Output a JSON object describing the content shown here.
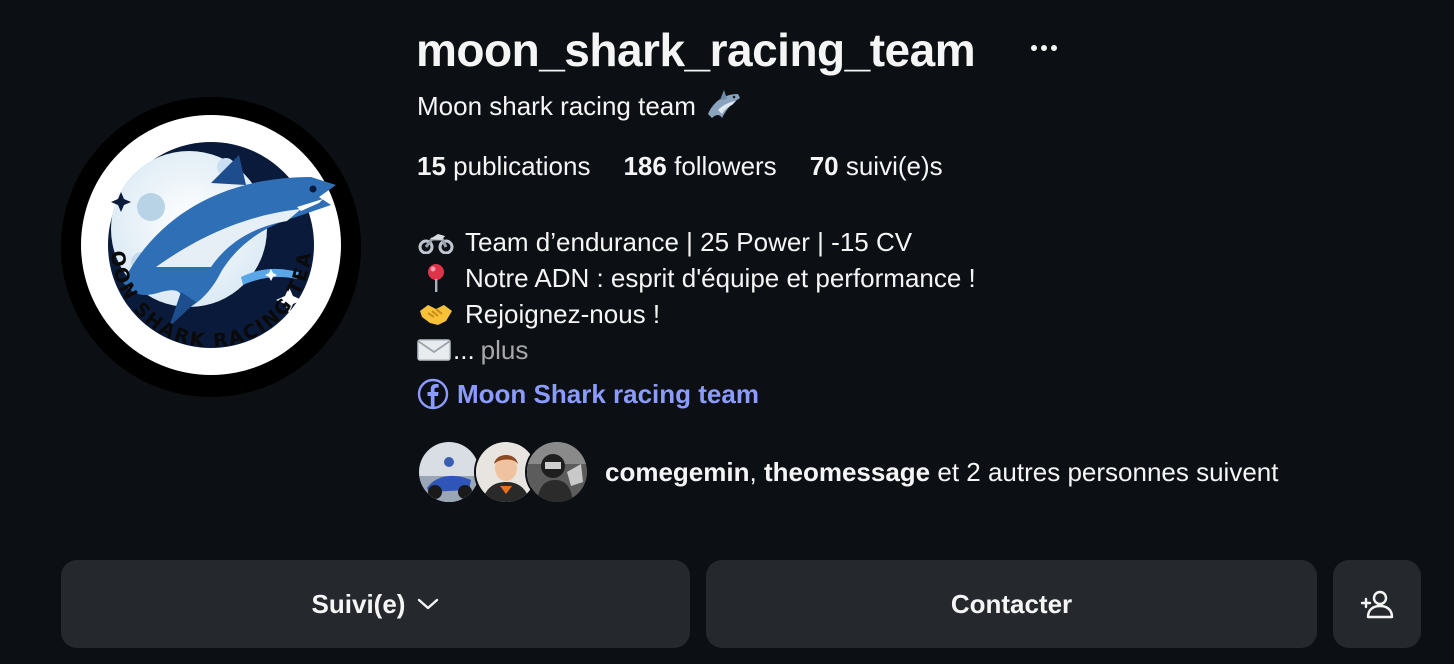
{
  "profile": {
    "username": "moon_shark_racing_team",
    "full_name": "Moon shark racing team",
    "name_emoji": "shark-emoji",
    "avatar_logo_text": "MOON SHARK RACING TEAM"
  },
  "more_icon": "ellipsis-icon",
  "stats": {
    "publications": {
      "count": "15",
      "label": "publications"
    },
    "followers": {
      "count": "186",
      "label": "followers"
    },
    "following": {
      "count": "70",
      "label": "suivi(e)s"
    }
  },
  "bio": {
    "lines": [
      {
        "emoji": "motorcycle-icon",
        "text": "Team d’endurance | 25 Power | -15 CV"
      },
      {
        "emoji": "round-pushpin-icon",
        "text": "Notre ADN : esprit d'équipe et performance !"
      },
      {
        "emoji": "handshake-icon",
        "text": "Rejoignez-nous !"
      },
      {
        "emoji": "envelope-icon",
        "text": "...",
        "more_label": "plus"
      }
    ]
  },
  "link": {
    "icon": "facebook-icon",
    "text": "Moon Shark racing team",
    "color": "#8c9bff"
  },
  "followed_by": {
    "names": [
      "comegemin",
      "theomessage"
    ],
    "separator": ", ",
    "suffix": " et 2 autres personnes suivent"
  },
  "buttons": {
    "follow_label": "Suivi(e)",
    "contact_label": "Contacter",
    "add_user_icon": "add-user-icon"
  },
  "colors": {
    "background": "#0c1014",
    "button_bg": "#25292e",
    "text": "#f5f5f5",
    "muted": "#a8a8a8"
  }
}
